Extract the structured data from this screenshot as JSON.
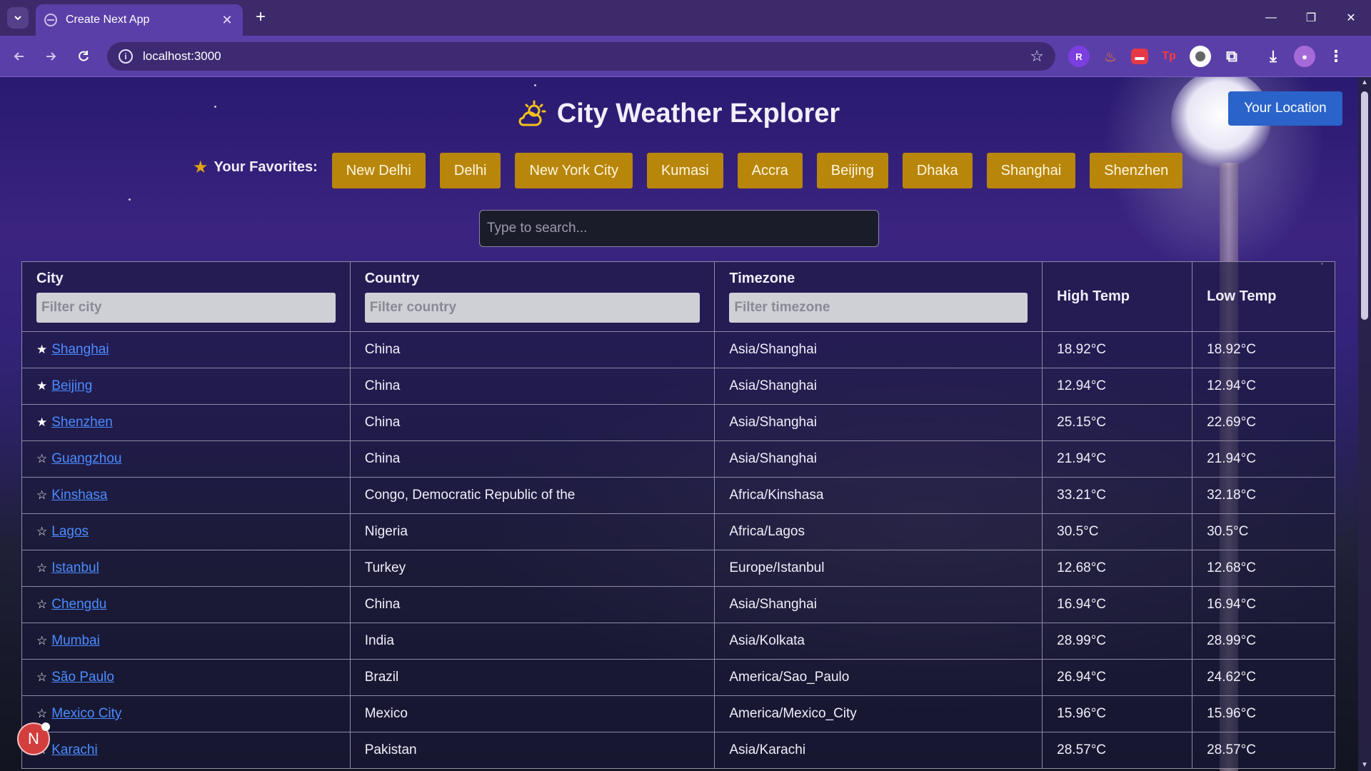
{
  "browser": {
    "tab_title": "Create Next App",
    "tab_close": "✕",
    "new_tab": "+",
    "url": "localhost:3000",
    "window_minimize": "—",
    "window_restore": "❐",
    "window_close": "✕"
  },
  "app": {
    "title": "City Weather Explorer",
    "location_button": "Your Location",
    "favorites_label": "Your Favorites:",
    "favorites": [
      "New Delhi",
      "Delhi",
      "New York City",
      "Kumasi",
      "Accra",
      "Beijing",
      "Dhaka",
      "Shanghai",
      "Shenzhen"
    ],
    "search_placeholder": "Type to search...",
    "avatar_letter": "N",
    "colors": {
      "favorite_button": "#b8860b",
      "location_button": "#2a63c9",
      "link": "#4b8cff",
      "star": "#e0a410"
    }
  },
  "table": {
    "headers": {
      "city": "City",
      "country": "Country",
      "timezone": "Timezone",
      "high": "High Temp",
      "low": "Low Temp"
    },
    "filters": {
      "city": "Filter city",
      "country": "Filter country",
      "timezone": "Filter timezone"
    },
    "rows": [
      {
        "fav": "★",
        "city": "Shanghai",
        "country": "China",
        "timezone": "Asia/Shanghai",
        "high": "18.92°C",
        "low": "18.92°C"
      },
      {
        "fav": "★",
        "city": "Beijing",
        "country": "China",
        "timezone": "Asia/Shanghai",
        "high": "12.94°C",
        "low": "12.94°C"
      },
      {
        "fav": "★",
        "city": "Shenzhen",
        "country": "China",
        "timezone": "Asia/Shanghai",
        "high": "25.15°C",
        "low": "22.69°C"
      },
      {
        "fav": "☆",
        "city": "Guangzhou",
        "country": "China",
        "timezone": "Asia/Shanghai",
        "high": "21.94°C",
        "low": "21.94°C"
      },
      {
        "fav": "☆",
        "city": "Kinshasa",
        "country": "Congo, Democratic Republic of the",
        "timezone": "Africa/Kinshasa",
        "high": "33.21°C",
        "low": "32.18°C"
      },
      {
        "fav": "☆",
        "city": "Lagos",
        "country": "Nigeria",
        "timezone": "Africa/Lagos",
        "high": "30.5°C",
        "low": "30.5°C"
      },
      {
        "fav": "☆",
        "city": "Istanbul",
        "country": "Turkey",
        "timezone": "Europe/Istanbul",
        "high": "12.68°C",
        "low": "12.68°C"
      },
      {
        "fav": "☆",
        "city": "Chengdu",
        "country": "China",
        "timezone": "Asia/Shanghai",
        "high": "16.94°C",
        "low": "16.94°C"
      },
      {
        "fav": "☆",
        "city": "Mumbai",
        "country": "India",
        "timezone": "Asia/Kolkata",
        "high": "28.99°C",
        "low": "28.99°C"
      },
      {
        "fav": "☆",
        "city": "São Paulo",
        "country": "Brazil",
        "timezone": "America/Sao_Paulo",
        "high": "26.94°C",
        "low": "24.62°C"
      },
      {
        "fav": "☆",
        "city": "Mexico City",
        "country": "Mexico",
        "timezone": "America/Mexico_City",
        "high": "15.96°C",
        "low": "15.96°C"
      },
      {
        "fav": "☆",
        "city": "Karachi",
        "country": "Pakistan",
        "timezone": "Asia/Karachi",
        "high": "28.57°C",
        "low": "28.57°C"
      }
    ]
  }
}
